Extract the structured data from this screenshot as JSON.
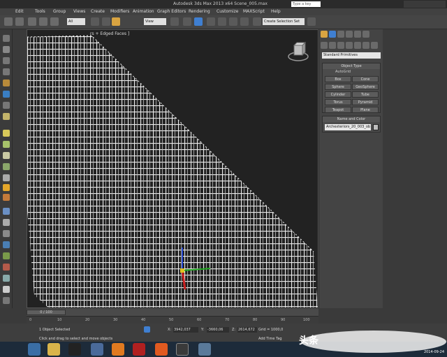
{
  "window": {
    "title": "Autodesk 3ds Max 2013 x64     Scene_005.max",
    "search_placeholder": "Type a key"
  },
  "menu": [
    "Edit",
    "Tools",
    "Group",
    "Views",
    "Create",
    "Modifiers",
    "Animation",
    "Graph Editors",
    "Rendering",
    "Customize",
    "MAXScript",
    "Help"
  ],
  "toolbar": {
    "filter_value": "All",
    "refsys_value": "View",
    "selection_set_value": "Create Selection Set"
  },
  "viewport": {
    "label": "[ + ] [Perspective] [Realistic + Edged Faces ]",
    "label_visible": "rs + Edged Faces ]"
  },
  "command_panel": {
    "category": "Standard Primitives",
    "object_type_title": "Object Type",
    "autogrid_label": "AutoGrid",
    "primitives": [
      "Box",
      "Cone",
      "Sphere",
      "GeoSphere",
      "Cylinder",
      "Tube",
      "Torus",
      "Pyramid",
      "Teapot",
      "Plane"
    ],
    "name_color_title": "Name and Color",
    "object_name": "Archexteriors_20_003_ob",
    "object_color": "#bdbdbd"
  },
  "timeline": {
    "frame_readout": "0 / 100",
    "ticks": [
      "0",
      "10",
      "20",
      "30",
      "40",
      "50",
      "60",
      "70",
      "80",
      "90",
      "100"
    ]
  },
  "status": {
    "selection": "1 Object Selected",
    "prompt": "Click and drag to select and move objects",
    "x_label": "X:",
    "x_value": "3942,037",
    "y_label": "Y:",
    "y_value": "-3660,06",
    "z_label": "Z:",
    "z_value": "2614,672",
    "grid": "Grid = 1000,0",
    "add_time_tag": "Add Time Tag"
  },
  "taskbar": {
    "date": "2014-09-24"
  },
  "watermark": "头条",
  "colors": {
    "background": "#3a3a3a",
    "viewport_bg": "#222222",
    "mesh": "#e8e8e8",
    "taskbar": "#1d2b3a"
  }
}
